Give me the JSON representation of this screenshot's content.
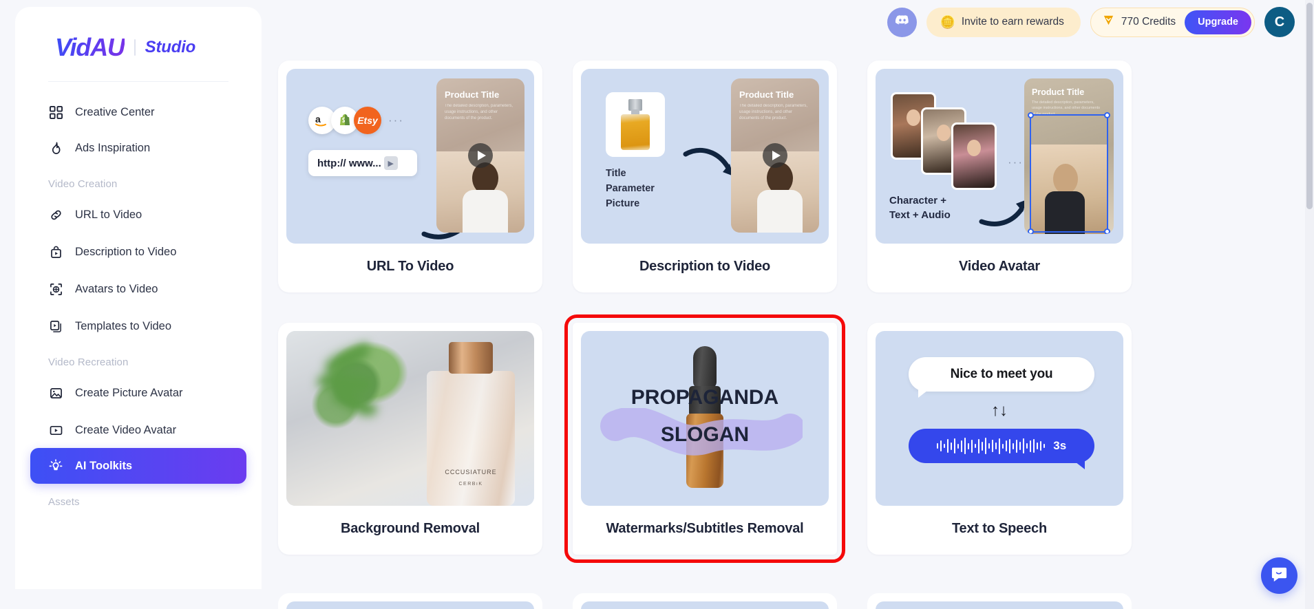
{
  "brand": {
    "logo": "VidAU",
    "studio": "Studio"
  },
  "header": {
    "discord_icon": "discord-icon",
    "invite": {
      "icon": "coins-icon",
      "label": "Invite to earn rewards"
    },
    "credits": {
      "icon": "diamond-icon",
      "label": "770 Credits",
      "upgrade_label": "Upgrade"
    },
    "avatar_initial": "C"
  },
  "sidebar": {
    "top_items": [
      {
        "label": "Creative Center",
        "icon": "grid-icon"
      },
      {
        "label": "Ads Inspiration",
        "icon": "flame-icon"
      }
    ],
    "groups": [
      {
        "label": "Video Creation",
        "items": [
          {
            "label": "URL to Video",
            "icon": "link-icon"
          },
          {
            "label": "Description to Video",
            "icon": "bag-play-icon"
          },
          {
            "label": "Avatars to Video",
            "icon": "target-person-icon"
          },
          {
            "label": "Templates to Video",
            "icon": "template-play-icon"
          }
        ]
      },
      {
        "label": "Video Recreation",
        "items": [
          {
            "label": "Create Picture Avatar",
            "icon": "image-icon"
          },
          {
            "label": "Create Video Avatar",
            "icon": "video-play-icon"
          }
        ]
      }
    ],
    "active_item": {
      "label": "AI Toolkits",
      "icon": "lightbulb-icon"
    },
    "assets_label": "Assets"
  },
  "cards": [
    {
      "id": "url-to-video",
      "title": "URL To Video",
      "media": {
        "logos": [
          "a",
          "S",
          "Etsy"
        ],
        "more": "···",
        "url_text": "http:// www...",
        "go_icon": "chevron-right-icon",
        "phone_title": "Product Title",
        "phone_desc": "The detailed description, parameters, usage instructions, and other documents of the product."
      },
      "highlighted": false
    },
    {
      "id": "description-to-video",
      "title": "Description to Video",
      "media": {
        "labels": "Title\nParameter\nPicture",
        "phone_title": "Product Title",
        "phone_desc": "The detailed description, parameters, usage instructions, and other documents of the product."
      },
      "highlighted": false
    },
    {
      "id": "video-avatar",
      "title": "Video Avatar",
      "media": {
        "caption": "Character +\nText + Audio",
        "more": "···",
        "phone_title": "Product Title",
        "phone_desc": "The detailed description, parameters, usage instructions, and other documents of the product."
      },
      "highlighted": false
    },
    {
      "id": "background-removal",
      "title": "Background Removal",
      "media": {
        "bottle_label_1": "CCCUSIATURE",
        "bottle_label_2": "CERBıK"
      },
      "highlighted": false
    },
    {
      "id": "watermarks-subtitles-removal",
      "title": "Watermarks/Subtitles Removal",
      "media": {
        "overlay_line_1": "PROPAGANDA",
        "overlay_line_2": "SLOGAN"
      },
      "highlighted": true,
      "highlight_color": "#f50a0a"
    },
    {
      "id": "text-to-speech",
      "title": "Text to Speech",
      "media": {
        "bubble_text": "Nice to meet you",
        "swap_icon": "↑↓",
        "duration": "3s"
      },
      "highlighted": false
    }
  ],
  "chat_widget": {
    "icon": "chat-smile-icon"
  },
  "colors": {
    "accent_start": "#3d50f5",
    "accent_end": "#6b3cf0",
    "card_media_bg": "#cfdcf1",
    "highlight": "#f50a0a",
    "credits_bg": "#fff8e9",
    "invite_bg": "#fdedcd"
  }
}
